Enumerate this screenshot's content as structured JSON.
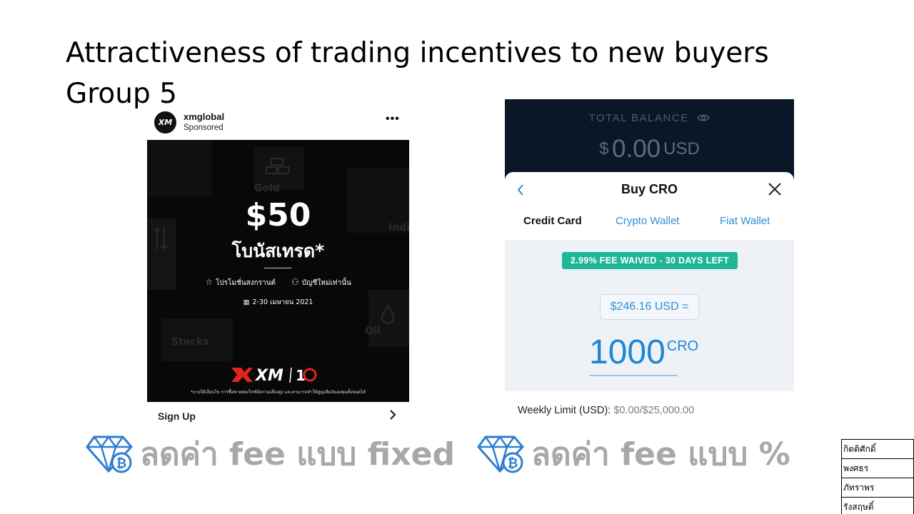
{
  "slide": {
    "title_line1": "Attractiveness of trading incentives to new buyers",
    "title_line2": "Group 5"
  },
  "ig_ad": {
    "avatar_text": "XM",
    "account": "xmglobal",
    "sponsored": "Sponsored",
    "more": "•••",
    "bonus_amount": "$50",
    "bonus_text": "โบนัสเทรด*",
    "promo_left": "โปรโมชั่นสงกรานต์",
    "promo_right": "บัญชีใหม่เท่านั้น",
    "date_range": "2-30 เมษายน 2021",
    "disclaimer": "*ภายใต้เงื่อนไข การซื้อขายฟอเร็กซ์มีความเสี่ยงสูง และสามารถทำให้สูญเสียเงินลงทุนทั้งหมดได้",
    "bg_labels": {
      "gold": "Gold",
      "indices": "Indi",
      "stocks": "Stocks",
      "oil": "Oil"
    },
    "cta_label": "Sign Up"
  },
  "crypto_app": {
    "balance_label": "TOTAL BALANCE",
    "balance_currency": "$",
    "balance_amount": "0.00",
    "balance_unit": "USD",
    "sheet_title": "Buy CRO",
    "tabs": [
      {
        "label": "Credit Card",
        "active": true
      },
      {
        "label": "Crypto Wallet",
        "active": false
      },
      {
        "label": "Fiat Wallet",
        "active": false
      }
    ],
    "fee_badge": "2.99% FEE WAIVED - 30 DAYS LEFT",
    "usd_value": "$246.16 USD =",
    "cro_amount": "1000",
    "cro_symbol": "CRO",
    "weekly_limit_label": "Weekly Limit (USD):",
    "weekly_limit_value": "$0.00/$25,000.00",
    "colors": {
      "accent": "#2d8fd5",
      "badge": "#1fb597",
      "dark_bg": "#0a1729"
    }
  },
  "fee_labels": {
    "left": "ลดค่า fee แบบ fixed",
    "right": "ลดค่า fee แบบ %",
    "icon": "diamond-bitcoin-icon",
    "icon_color": "#2e7fd1",
    "text_color": "#a8a8a8"
  },
  "members": [
    "กิตติศักดิ์",
    "พงศธร",
    "ภัทราพร",
    "รังสฤษดิ์"
  ]
}
